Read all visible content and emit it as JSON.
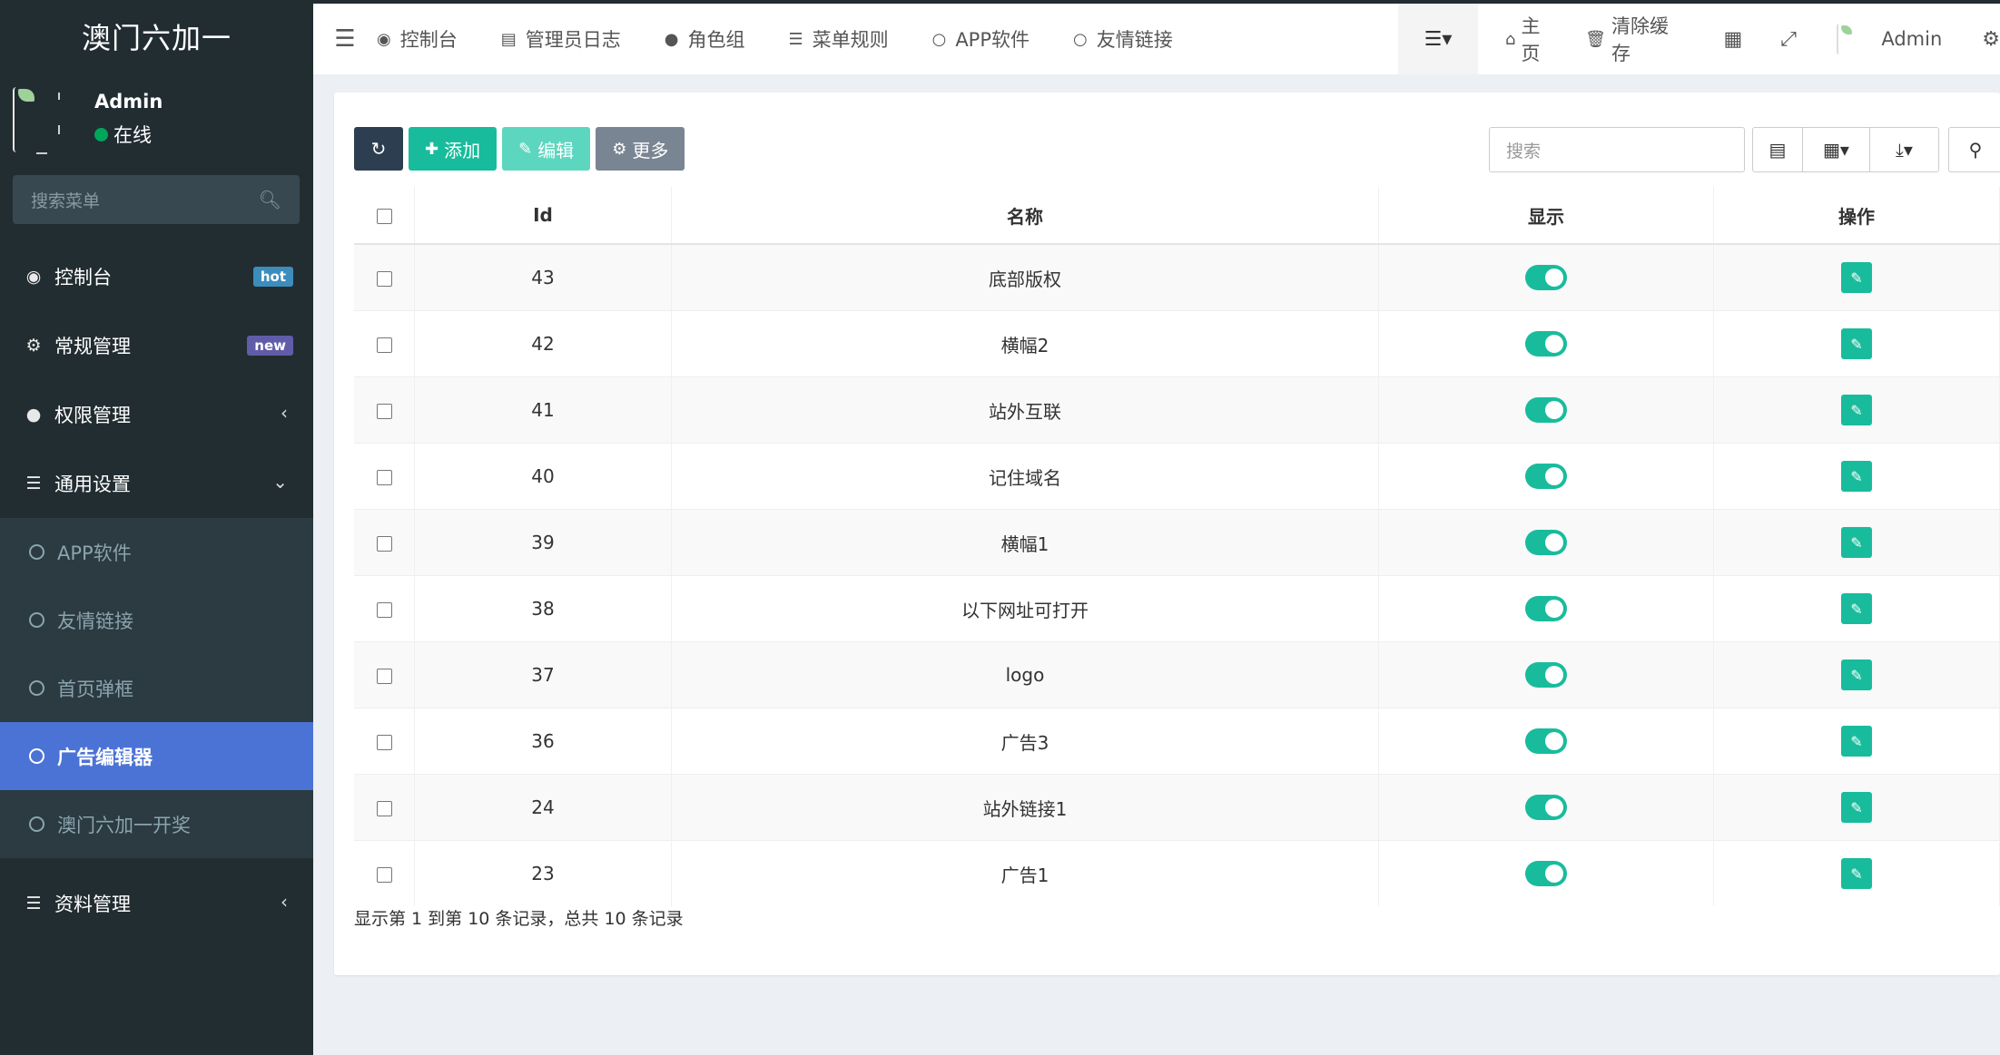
{
  "app": {
    "brand": "澳门六加一"
  },
  "user": {
    "name": "Admin",
    "status": "在线"
  },
  "sidebar": {
    "search_placeholder": "搜索菜单",
    "items": [
      {
        "label": "控制台",
        "badge": "hot"
      },
      {
        "label": "常规管理",
        "badge": "new"
      },
      {
        "label": "权限管理"
      },
      {
        "label": "通用设置"
      }
    ],
    "submenu": [
      {
        "label": "APP软件"
      },
      {
        "label": "友情链接"
      },
      {
        "label": "首页弹框"
      },
      {
        "label": "广告编辑器",
        "active": true
      },
      {
        "label": "澳门六加一开奖"
      }
    ],
    "after": [
      {
        "label": "资料管理"
      }
    ]
  },
  "topbar": {
    "tabs": [
      {
        "label": "控制台",
        "icon": "dashboard-icon"
      },
      {
        "label": "管理员日志",
        "icon": "list-alt-icon"
      },
      {
        "label": "角色组",
        "icon": "group-icon"
      },
      {
        "label": "菜单规则",
        "icon": "bars-icon"
      },
      {
        "label": "APP软件",
        "icon": "circle-icon"
      },
      {
        "label": "友情链接",
        "icon": "circle-icon"
      }
    ],
    "home": "主页",
    "clear_cache": "清除缓存",
    "admin": "Admin"
  },
  "toolbar": {
    "add": "添加",
    "edit": "编辑",
    "more": "更多",
    "search_placeholder": "搜索"
  },
  "table": {
    "headers": {
      "id": "Id",
      "name": "名称",
      "show": "显示",
      "actions": "操作"
    },
    "rows": [
      {
        "id": "43",
        "name": "底部版权",
        "show": true
      },
      {
        "id": "42",
        "name": "横幅2",
        "show": true
      },
      {
        "id": "41",
        "name": "站外互联",
        "show": true
      },
      {
        "id": "40",
        "name": "记住域名",
        "show": true
      },
      {
        "id": "39",
        "name": "横幅1",
        "show": true
      },
      {
        "id": "38",
        "name": "以下网址可打开",
        "show": true
      },
      {
        "id": "37",
        "name": "logo",
        "show": true
      },
      {
        "id": "36",
        "name": "广告3",
        "show": true
      },
      {
        "id": "24",
        "name": "站外链接1",
        "show": true
      },
      {
        "id": "23",
        "name": "广告1",
        "show": true
      }
    ]
  },
  "pagination": {
    "summary": "显示第 1 到第 10 条记录，总共 10 条记录"
  },
  "colors": {
    "primary": "#18bc9c",
    "sidebar": "#222d32",
    "active": "#4b73d6"
  }
}
